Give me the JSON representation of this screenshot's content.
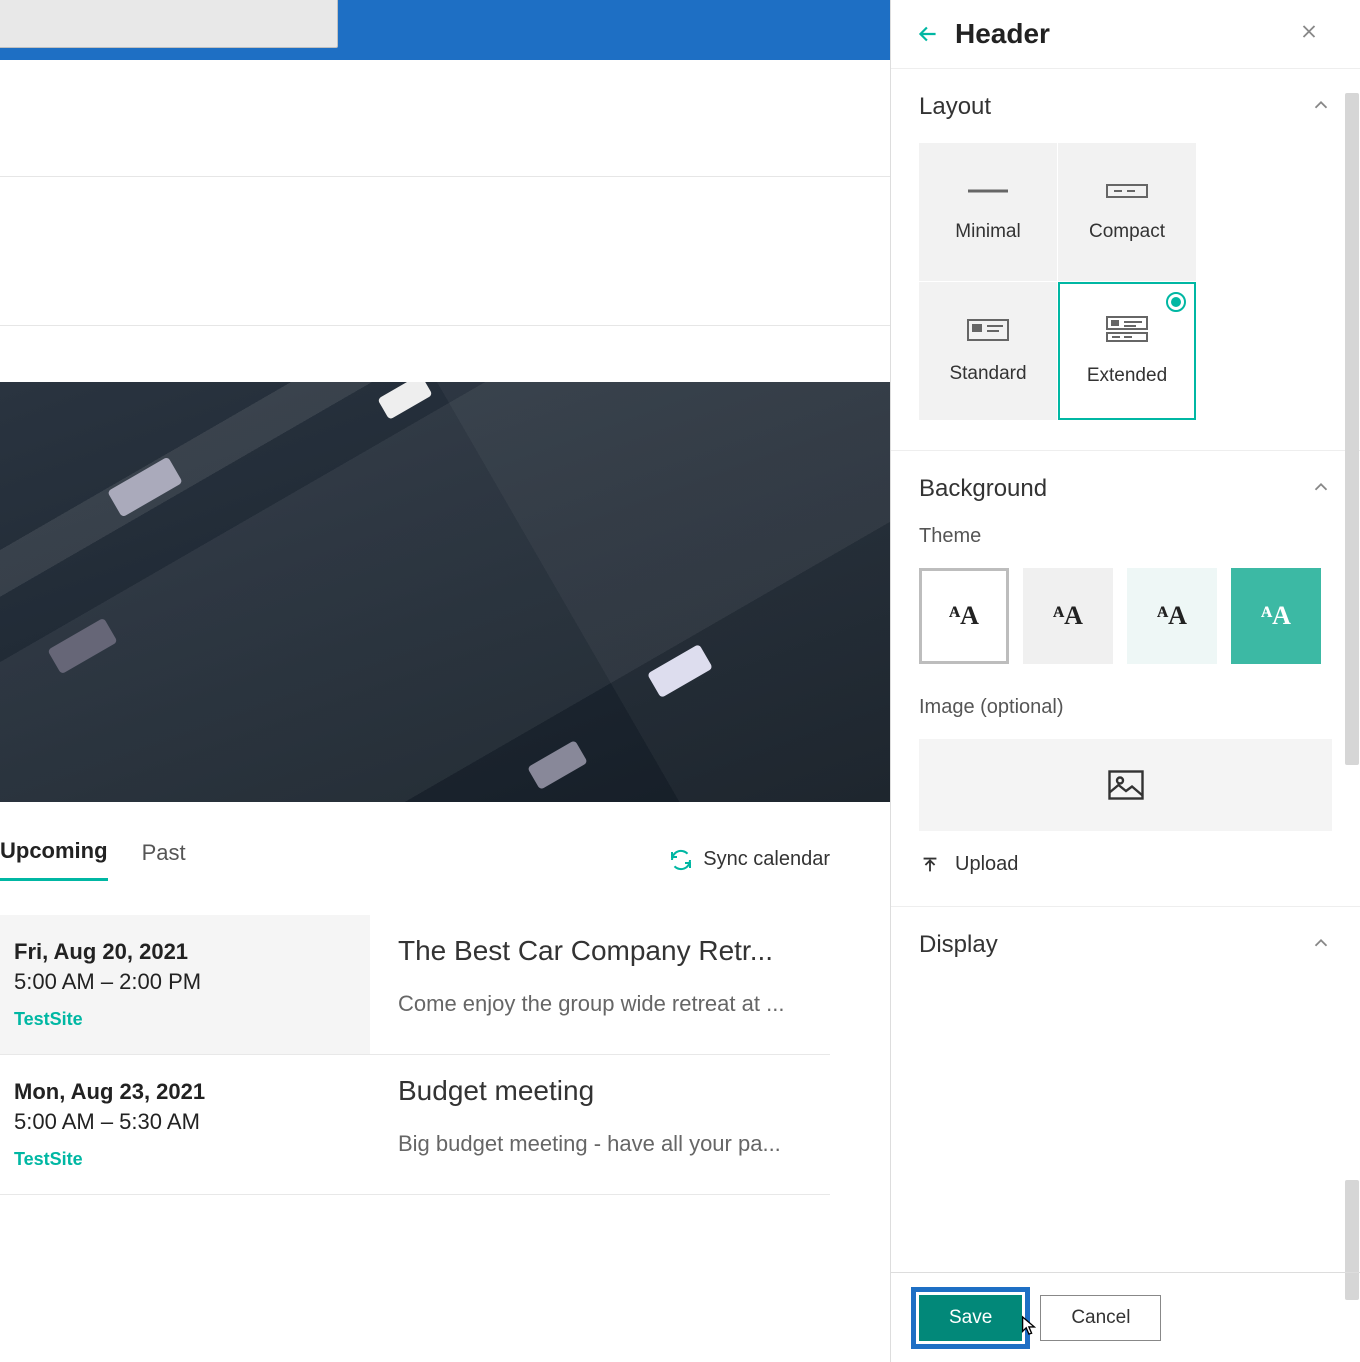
{
  "panel": {
    "title": "Header",
    "sections": {
      "layout": {
        "title": "Layout",
        "options": {
          "minimal": "Minimal",
          "compact": "Compact",
          "standard": "Standard",
          "extended": "Extended"
        },
        "selected": "extended"
      },
      "background": {
        "title": "Background",
        "themeLabel": "Theme",
        "themes": [
          "white",
          "light",
          "tint",
          "accent"
        ],
        "selectedTheme": "white",
        "imageLabel": "Image (optional)",
        "uploadLabel": "Upload"
      },
      "display": {
        "title": "Display"
      }
    },
    "footer": {
      "save": "Save",
      "cancel": "Cancel"
    }
  },
  "tabs": {
    "upcoming": "Upcoming",
    "past": "Past",
    "active": "upcoming",
    "syncLabel": "Sync calendar"
  },
  "events": [
    {
      "date": "Fri, Aug 20, 2021",
      "time": "5:00 AM – 2:00 PM",
      "site": "TestSite",
      "title": "The Best Car Company Retr...",
      "desc": "Come enjoy the group wide retreat at ..."
    },
    {
      "date": "Mon, Aug 23, 2021",
      "time": "5:00 AM – 5:30 AM",
      "site": "TestSite",
      "title": "Budget meeting",
      "desc": "Big budget meeting - have all your pa..."
    }
  ],
  "colors": {
    "accent": "#00b7a3",
    "topbar": "#1e6fc4"
  }
}
